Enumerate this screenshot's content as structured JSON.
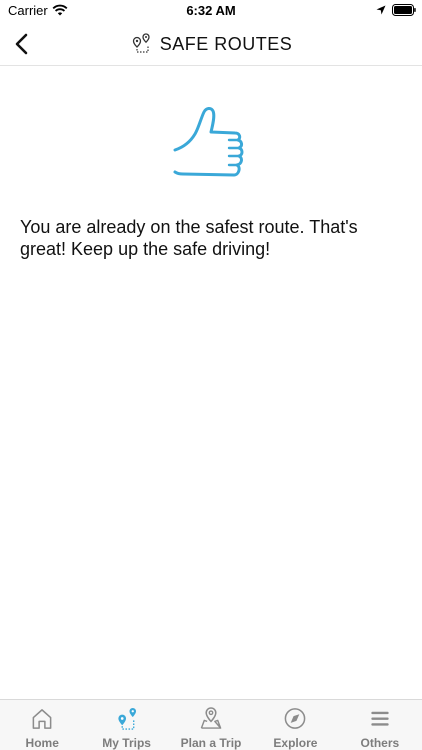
{
  "status_bar": {
    "carrier": "Carrier",
    "time": "6:32 AM"
  },
  "nav": {
    "title": "SAFE ROUTES",
    "back_icon": "chevron-left-icon",
    "title_icon": "route-pins-icon"
  },
  "content": {
    "icon": "thumbs-up-icon",
    "message": "You are already on the safest route. That's great! Keep up the safe driving!"
  },
  "tabs": [
    {
      "label": "Home",
      "icon": "home-icon",
      "active": false
    },
    {
      "label": "My Trips",
      "icon": "trips-pins-icon",
      "active": true
    },
    {
      "label": "Plan a Trip",
      "icon": "map-pin-icon",
      "active": false
    },
    {
      "label": "Explore",
      "icon": "compass-icon",
      "active": false
    },
    {
      "label": "Others",
      "icon": "menu-icon",
      "active": false
    }
  ],
  "colors": {
    "accent": "#3aa8d8",
    "tab_icon": "#8c8c8c",
    "tab_label": "#7d7d7d"
  }
}
